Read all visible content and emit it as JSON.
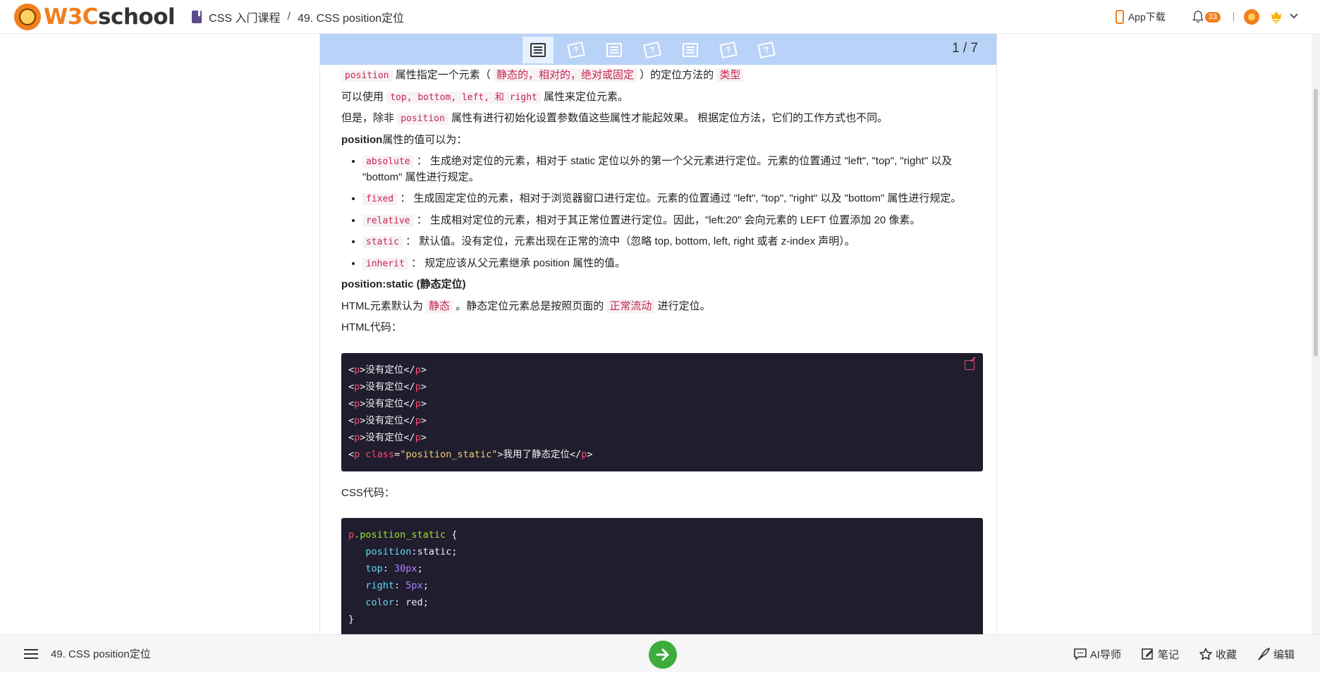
{
  "header": {
    "logo_w3": "W3C",
    "logo_school": "school",
    "breadcrumb_course": "CSS 入门课程",
    "breadcrumb_sep": "/",
    "breadcrumb_page": "49. CSS position定位",
    "app_download": "App下载",
    "notification_count": "33",
    "brand_color": "#f07f1d"
  },
  "stepper": {
    "count": "1 / 7",
    "active_color": "#e6f0ff",
    "bar_color": "#b9d2f7",
    "steps": [
      "doc",
      "quiz",
      "doc",
      "quiz",
      "doc",
      "quiz",
      "quiz"
    ]
  },
  "article": {
    "p1": {
      "code": "position",
      "t1": "属性指定一个元素（",
      "hl1": "静态的，相对的，绝对或固定",
      "t2": "）的定位方法的",
      "hl2": "类型"
    },
    "p2": {
      "t1": "可以使用",
      "code": "top, bottom, left, 和 right",
      "t2": "属性来定位元素。"
    },
    "p3": {
      "t1": "但是，除非",
      "code": "position",
      "t2": "属性有进行初始化设置参数值这些属性才能起效果。 根据定位方法，它们的工作方式也不同。"
    },
    "p4": {
      "strong": "position",
      "t": "属性的值可以为："
    },
    "list": [
      {
        "code": "absolute",
        "text": "： 生成绝对定位的元素，相对于 static 定位以外的第一个父元素进行定位。元素的位置通过 \"left\", \"top\", \"right\" 以及 \"bottom\" 属性进行规定。"
      },
      {
        "code": "fixed",
        "text": "： 生成固定定位的元素，相对于浏览器窗口进行定位。元素的位置通过 \"left\", \"top\", \"right\" 以及 \"bottom\" 属性进行规定。"
      },
      {
        "code": "relative",
        "text": "： 生成相对定位的元素，相对于其正常位置进行定位。因此，\"left:20\" 会向元素的 LEFT 位置添加 20 像素。"
      },
      {
        "code": "static",
        "text": "： 默认值。没有定位，元素出现在正常的流中（忽略 top, bottom, left, right 或者 z-index 声明）。"
      },
      {
        "code": "inherit",
        "text": "： 规定应该从父元素继承 position 属性的值。"
      }
    ],
    "h_static": "position:static (静态定位)",
    "p5": {
      "t1": "HTML元素默认为",
      "hl1": "静态",
      "t2": "。静态定位元素总是按照页面的",
      "hl2": "正常流动",
      "t3": "进行定位。"
    },
    "html_label": "HTML代码：",
    "html_code": {
      "lines_text": [
        "没有定位",
        "没有定位",
        "没有定位",
        "没有定位",
        "没有定位"
      ],
      "last_attr": "class",
      "last_value": "\"position_static\"",
      "last_text": "我用了静态定位"
    },
    "css_label": "CSS代码：",
    "css_code": {
      "selector_tag": "p",
      "selector_class": ".position_static",
      "brace_open": "{",
      "decls": [
        {
          "prop": "position",
          "sep": ":",
          "val": "static",
          "num": false
        },
        {
          "prop": "top",
          "sep": ": ",
          "val": "30px",
          "num": true
        },
        {
          "prop": "right",
          "sep": ": ",
          "val": "5px",
          "num": true
        },
        {
          "prop": "color",
          "sep": ": ",
          "val": "red",
          "num": false
        }
      ],
      "brace_close": "}"
    }
  },
  "bottom": {
    "title": "49. CSS position定位",
    "ai": "AI导师",
    "notes": "笔记",
    "favorite": "收藏",
    "edit": "编辑",
    "next_color": "#3dac3d"
  }
}
